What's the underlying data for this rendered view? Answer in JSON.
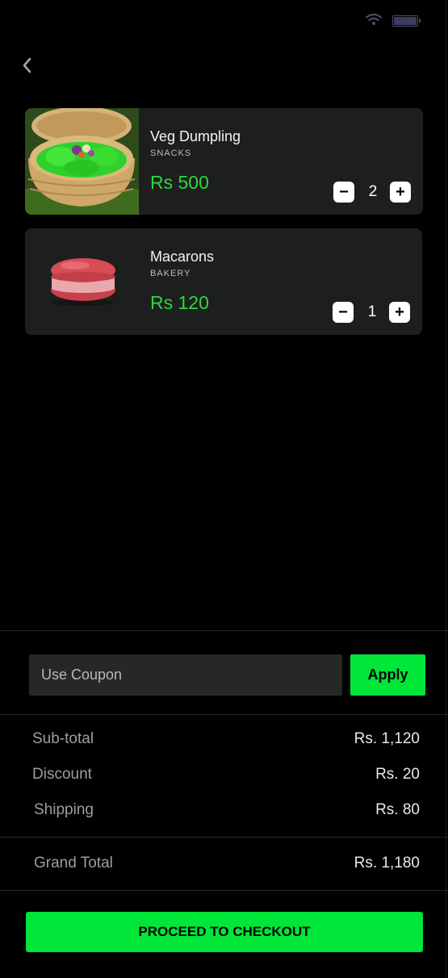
{
  "status_bar": {
    "wifi_icon": "wifi-icon",
    "battery_icon": "battery-icon"
  },
  "nav": {
    "back_icon": "chevron-left-icon"
  },
  "cart": {
    "items": [
      {
        "name": "Veg Dumpling",
        "category": "SNACKS",
        "price": "Rs 500",
        "quantity": "2",
        "minus": "−",
        "plus": "+"
      },
      {
        "name": "Macarons",
        "category": "BAKERY",
        "price": "Rs 120",
        "quantity": "1",
        "minus": "−",
        "plus": "+"
      }
    ]
  },
  "coupon": {
    "placeholder": "Use Coupon",
    "apply_label": "Apply"
  },
  "summary": {
    "subtotal_label": "Sub-total",
    "subtotal_value": "Rs. 1,120",
    "discount_label": "Discount",
    "discount_value": "Rs. 20",
    "shipping_label": "Shipping",
    "shipping_value": "Rs. 80",
    "grand_total_label": "Grand Total",
    "grand_total_value": "Rs. 1,180"
  },
  "checkout": {
    "label": "PROCEED TO CHECKOUT"
  },
  "colors": {
    "accent": "#00e639",
    "price": "#2cd83d",
    "card_bg": "#1d1f1f",
    "background": "#000000"
  }
}
